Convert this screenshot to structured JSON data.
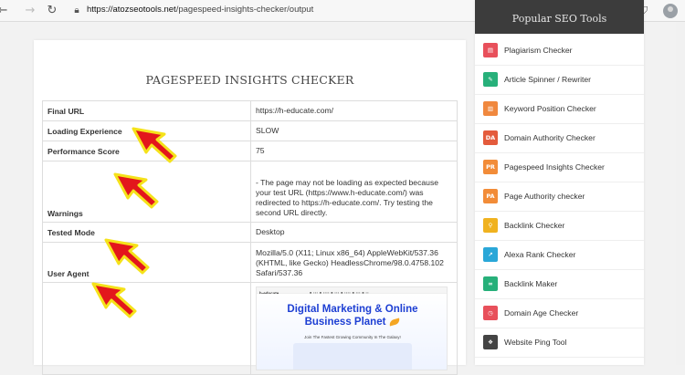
{
  "browser": {
    "url_domain": "https://atozseotools.net",
    "url_path": "/pagespeed-insights-checker/output"
  },
  "page": {
    "title": "PAGESPEED INSIGHTS CHECKER"
  },
  "results": [
    {
      "label": "Final URL",
      "value": "https://h-educate.com/"
    },
    {
      "label": "Loading Experience",
      "value": "SLOW"
    },
    {
      "label": "Performance Score",
      "value": "75"
    },
    {
      "label": "Warnings",
      "value": "- The page may not be loading as expected because your test URL (https://www.h-educate.com/) was redirected to https://h-educate.com/. Try testing the second URL directly."
    },
    {
      "label": "Tested Mode",
      "value": "Desktop"
    },
    {
      "label": "User Agent",
      "value": "Mozilla/5.0 (X11; Linux x86_64) AppleWebKit/537.36 (KHTML, like Gecko) HeadlessChrome/98.0.4758.102 Safari/537.36"
    }
  ],
  "screenshot": {
    "logo": "h-educate",
    "heading_line1": "Digital Marketing & Online",
    "heading_line2": "Business Planet",
    "subheading": "Join The Fastest Growing Community In The Galaxy!"
  },
  "sidebar": {
    "title": "Popular SEO Tools",
    "tools": [
      {
        "label": "Plagiarism Checker",
        "icon": "document-icon",
        "color": "#e8505b"
      },
      {
        "label": "Article Spinner / Rewriter",
        "icon": "pen-icon",
        "color": "#27b07a"
      },
      {
        "label": "Keyword Position Checker",
        "icon": "bar-chart-icon",
        "color": "#f0883e"
      },
      {
        "label": "Domain Authority Checker",
        "icon": "da-icon",
        "color": "#e45b3c"
      },
      {
        "label": "Pagespeed Insights Checker",
        "icon": "pr-icon",
        "color": "#f28c38"
      },
      {
        "label": "Page Authority checker",
        "icon": "pa-icon",
        "color": "#f28c38"
      },
      {
        "label": "Backlink Checker",
        "icon": "link-icon",
        "color": "#f0b21f"
      },
      {
        "label": "Alexa Rank Checker",
        "icon": "trend-icon",
        "color": "#2aa7d8"
      },
      {
        "label": "Backlink Maker",
        "icon": "chain-icon",
        "color": "#27b07a"
      },
      {
        "label": "Domain Age Checker",
        "icon": "clock-icon",
        "color": "#e8505b"
      },
      {
        "label": "Website Ping Tool",
        "icon": "ping-icon",
        "color": "#444444"
      }
    ]
  }
}
